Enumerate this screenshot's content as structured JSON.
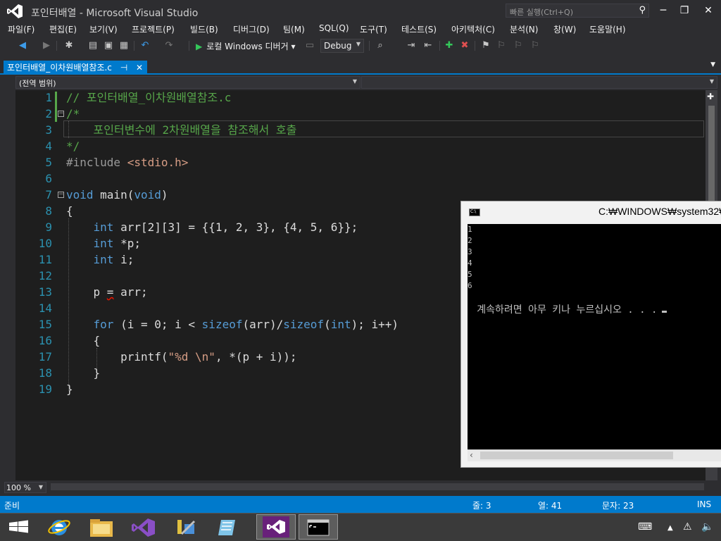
{
  "window": {
    "title": "포인터배열 - Microsoft Visual Studio",
    "quick_launch_placeholder": "빠른 실행(Ctrl+Q)"
  },
  "menu": {
    "items": [
      "파일(F)",
      "편집(E)",
      "보기(V)",
      "프로젝트(P)",
      "빌드(B)",
      "디버그(D)",
      "팀(M)",
      "SQL(Q)",
      "도구(T)",
      "테스트(S)",
      "아키텍처(C)",
      "분석(N)",
      "창(W)",
      "도움말(H)"
    ]
  },
  "toolbar": {
    "run_label": "로컬 Windows 디버거",
    "config": "Debug"
  },
  "document_tab": {
    "label": "포인터배열_이차원배열참조.c",
    "pin": "⊣",
    "close": "✕"
  },
  "navigation": {
    "scope": "(전역 범위)"
  },
  "editor": {
    "line_numbers": [
      "1",
      "2",
      "3",
      "4",
      "5",
      "6",
      "7",
      "8",
      "9",
      "10",
      "11",
      "12",
      "13",
      "14",
      "15",
      "16",
      "17",
      "18",
      "19"
    ],
    "lines": [
      "// 포인터배열_이차원배열참조.c",
      "/*",
      "    포인터변수에 2차원배열을 참조해서 호출",
      "*/",
      "#include <stdio.h>",
      "",
      "void main(void)",
      "{",
      "    int arr[2][3] = {{1, 2, 3}, {4, 5, 6}};",
      "    int *p;",
      "    int i;",
      "",
      "    p = arr;",
      "",
      "    for (i = 0; i < sizeof(arr)/sizeof(int); i++)",
      "    {",
      "        printf(\"%d \\n\", *(p + i));",
      "    }",
      "}"
    ],
    "zoom": "100 %"
  },
  "status": {
    "ready": "준비",
    "line": "줄: 3",
    "column": "열: 41",
    "char": "문자: 23",
    "mode": "INS"
  },
  "console": {
    "title": "C:₩WINDOWS₩system32₩",
    "output": [
      "1",
      "2",
      "3",
      "4",
      "5",
      "6"
    ],
    "prompt": "계속하려면 아무 키나 누르십시오 . . ."
  },
  "colors": {
    "accent": "#007acc",
    "editor_bg": "#1e1e1e",
    "chrome_bg": "#2d2d30",
    "keyword": "#569cd6",
    "comment": "#57a64a",
    "string": "#d69d85",
    "line_number": "#2b91af"
  }
}
